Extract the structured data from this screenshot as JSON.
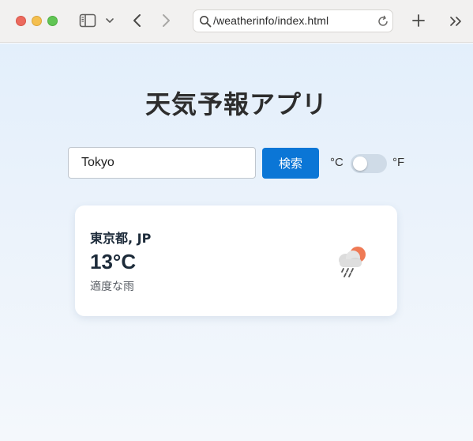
{
  "browser": {
    "address": "/weatherinfo/index.html",
    "icons": {
      "sidebar": "sidebar-icon",
      "back": "chevron-left-icon",
      "forward": "chevron-right-icon",
      "search": "magnifier-icon",
      "reload": "reload-icon",
      "new_tab": "plus-icon",
      "more": "double-chevron-right-icon"
    }
  },
  "app": {
    "title": "天気予報アプリ",
    "search": {
      "value": "Tokyo",
      "button_label": "検索"
    },
    "unit_toggle": {
      "celsius_label": "°C",
      "fahrenheit_label": "°F",
      "selected": "celsius"
    },
    "weather": {
      "location": "東京都, JP",
      "temperature": "13°C",
      "description": "適度な雨",
      "icon": "rain-cloud-sun-icon"
    }
  },
  "colors": {
    "accent": "#0b76d6",
    "title_text": "#2d2d2d",
    "card_text": "#1d2b3a",
    "sun": "#ef7a55"
  }
}
